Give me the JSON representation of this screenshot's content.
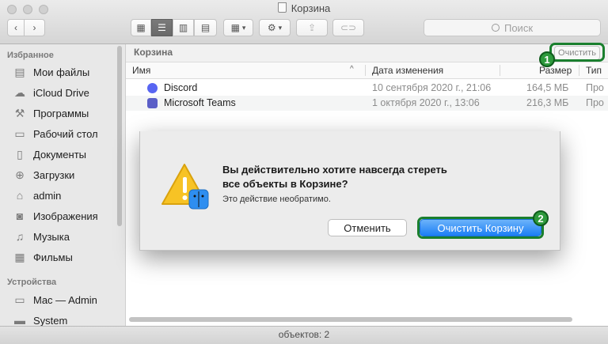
{
  "window": {
    "title": "Корзина"
  },
  "toolbar": {
    "search_placeholder": "Поиск"
  },
  "sidebar": {
    "favorites_header": "Избранное",
    "favorites": [
      {
        "label": "Мои файлы",
        "icon": "my-files-icon"
      },
      {
        "label": "iCloud Drive",
        "icon": "cloud-icon"
      },
      {
        "label": "Программы",
        "icon": "applications-icon"
      },
      {
        "label": "Рабочий стол",
        "icon": "desktop-icon"
      },
      {
        "label": "Документы",
        "icon": "documents-icon"
      },
      {
        "label": "Загрузки",
        "icon": "downloads-icon"
      },
      {
        "label": "admin",
        "icon": "home-icon"
      },
      {
        "label": "Изображения",
        "icon": "camera-icon"
      },
      {
        "label": "Музыка",
        "icon": "music-note-icon"
      },
      {
        "label": "Фильмы",
        "icon": "film-icon"
      }
    ],
    "devices_header": "Устройства",
    "devices": [
      {
        "label": "Mac — Admin",
        "icon": "computer-icon"
      },
      {
        "label": "System",
        "icon": "disk-icon"
      }
    ]
  },
  "main": {
    "path_title": "Корзина",
    "empty_button": "Очистить",
    "columns": {
      "name": "Имя",
      "date": "Дата изменения",
      "size": "Размер",
      "type": "Тип"
    },
    "rows": [
      {
        "name": "Discord",
        "date": "10 сентября 2020 г., 21:06",
        "size": "164,5 МБ",
        "type": "Про",
        "icon_color": "#5865f2"
      },
      {
        "name": "Microsoft Teams",
        "date": "1 октября 2020 г., 13:06",
        "size": "216,3 МБ",
        "type": "Про",
        "icon_color": "#5b5fc7"
      }
    ]
  },
  "status": {
    "text": "объектов: 2"
  },
  "dialog": {
    "title": "Вы действительно хотите навсегда стереть все объекты в Корзине?",
    "info": "Это действие необратимо.",
    "cancel_label": "Отменить",
    "confirm_label": "Очистить Корзину"
  },
  "annotations": {
    "badge1": "1",
    "badge2": "2",
    "color": "#2e9a3d"
  }
}
